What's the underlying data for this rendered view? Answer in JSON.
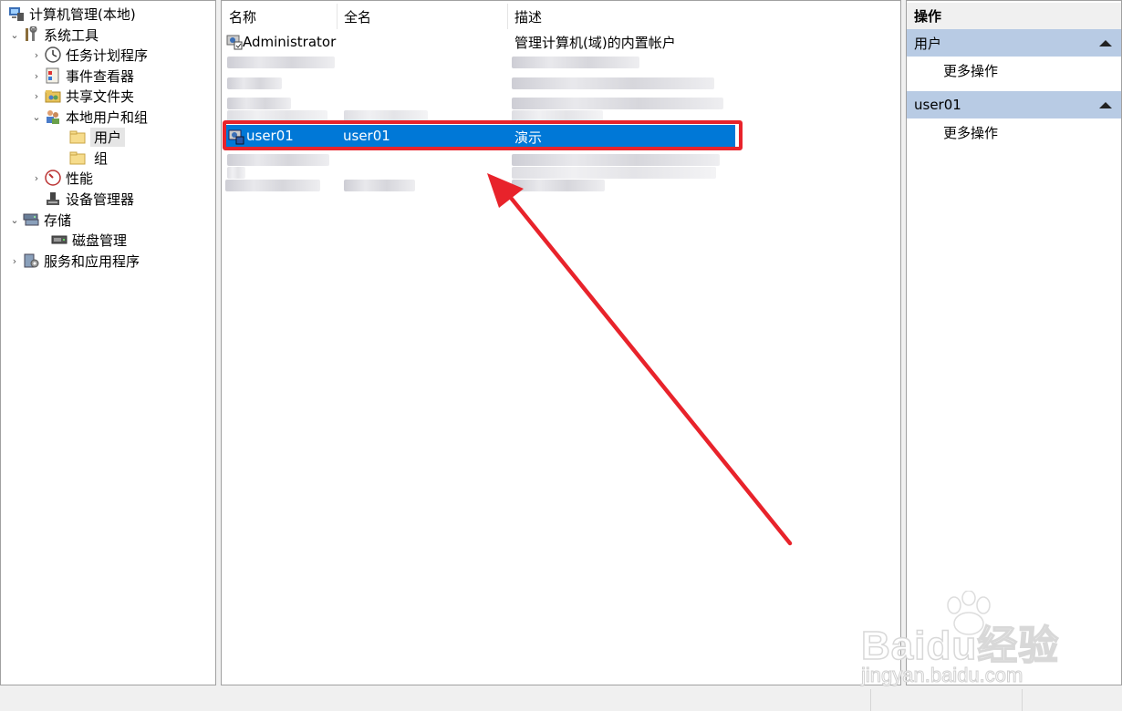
{
  "tree": {
    "root": "计算机管理(本地)",
    "system_tools": "系统工具",
    "task_scheduler": "任务计划程序",
    "event_viewer": "事件查看器",
    "shared_folders": "共享文件夹",
    "local_users_groups": "本地用户和组",
    "users": "用户",
    "groups": "组",
    "performance": "性能",
    "device_manager": "设备管理器",
    "storage": "存储",
    "disk_management": "磁盘管理",
    "services_apps": "服务和应用程序"
  },
  "list": {
    "columns": [
      "名称",
      "全名",
      "描述"
    ],
    "rows": [
      {
        "name": "Administrator",
        "full_name": "",
        "description": "管理计算机(域)的内置帐户"
      },
      {
        "name": "user01",
        "full_name": "user01",
        "description": "演示"
      }
    ]
  },
  "actions": {
    "title": "操作",
    "section1": "用户",
    "section1_more": "更多操作",
    "section2": "user01",
    "section2_more": "更多操作"
  },
  "watermark": {
    "brand": "Baidu经验",
    "sub": "jingyan.baidu.com"
  },
  "colors": {
    "selection": "#0078d7",
    "highlight": "#e8232b",
    "action_header": "#b8cbe4"
  }
}
